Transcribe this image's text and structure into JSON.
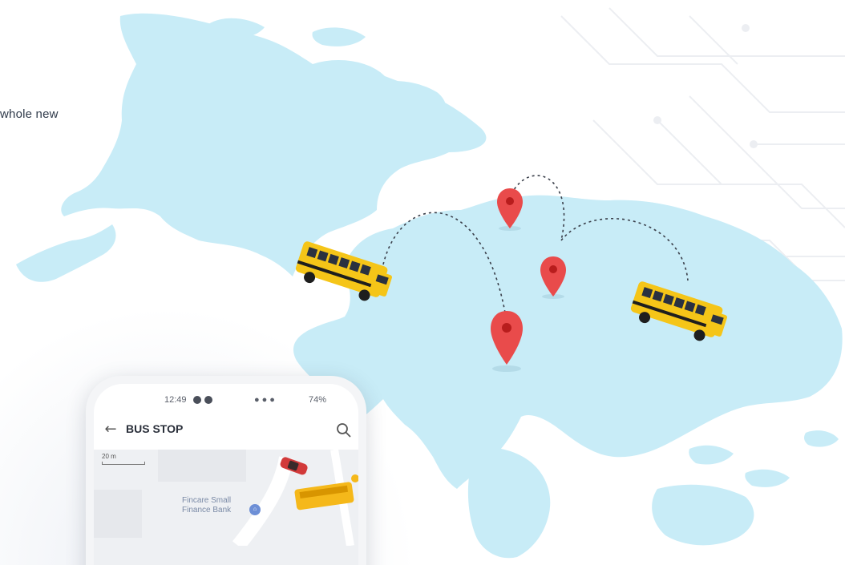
{
  "hero": {
    "headline_fragment": "whole new"
  },
  "phone": {
    "status_time": "12:49",
    "status_battery": "74%",
    "app_title": "BUS STOP",
    "map_scale": "20 m",
    "poi_name": "Fincare Small Finance Bank"
  },
  "icons": [
    "back-arrow-icon",
    "search-icon",
    "map-pin-icon",
    "school-bus-icon",
    "car-icon",
    "bank-icon"
  ],
  "colors": {
    "map_land": "#c8ecf7",
    "pin_red": "#e94b4b",
    "bus_yellow": "#f5c518",
    "text_dark": "#2f3a4a"
  }
}
